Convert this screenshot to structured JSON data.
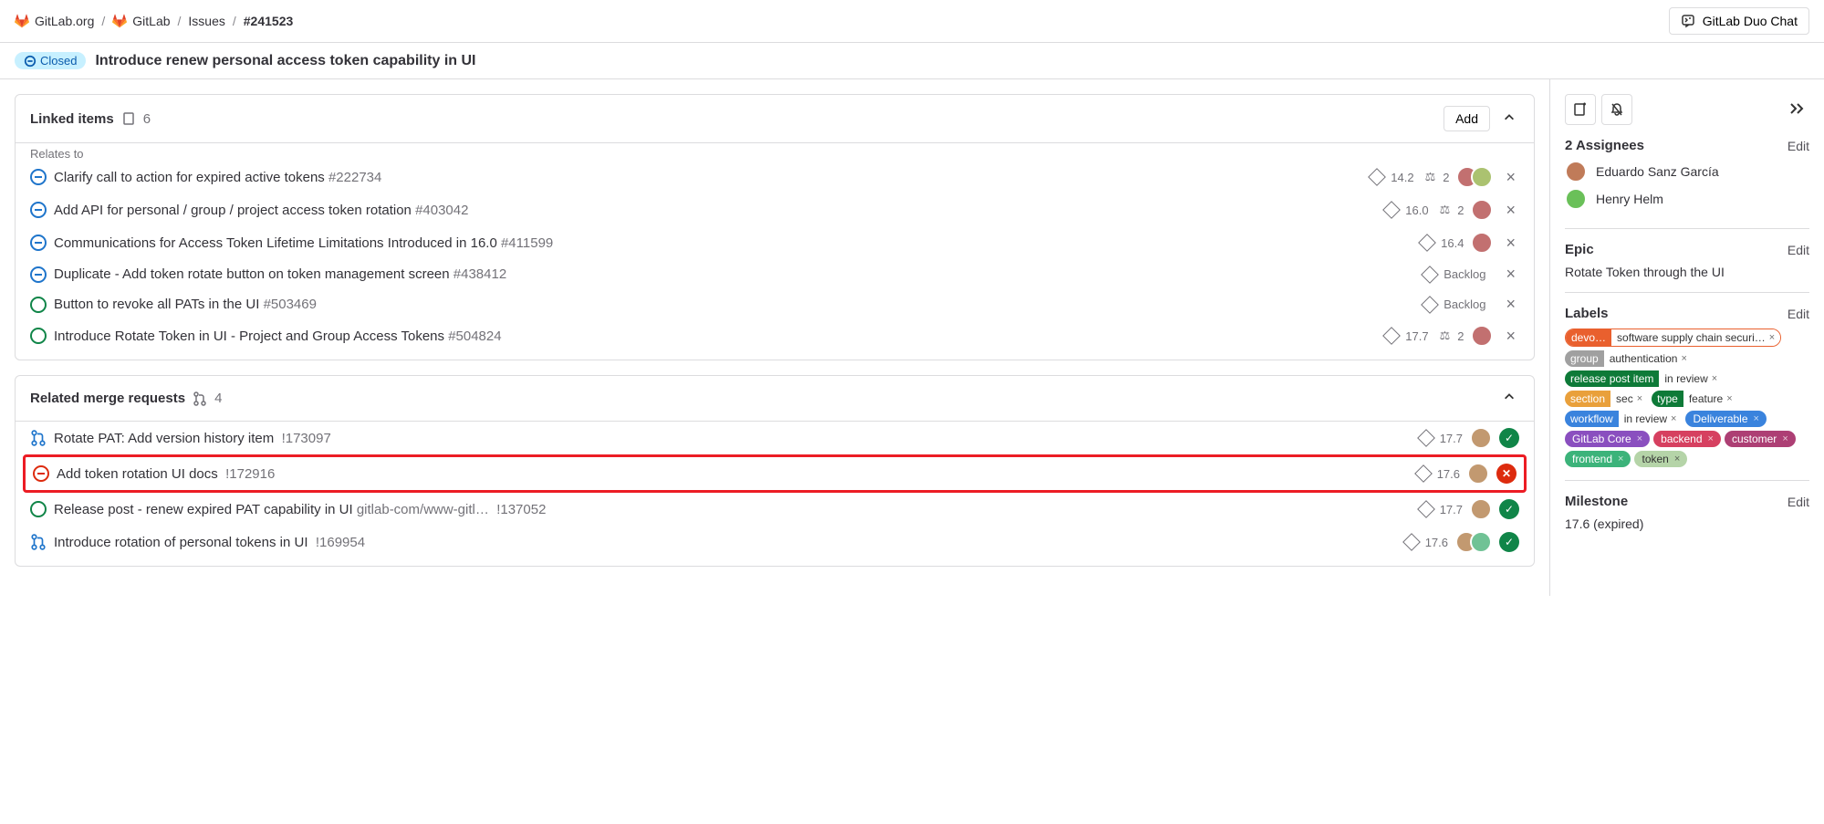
{
  "breadcrumbs": {
    "org": "GitLab.org",
    "project": "GitLab",
    "section": "Issues",
    "ref": "#241523"
  },
  "duo_chat": "GitLab Duo Chat",
  "status": "Closed",
  "title": "Introduce renew personal access token capability in UI",
  "linked_items": {
    "heading": "Linked items",
    "count": "6",
    "add": "Add",
    "relates_to": "Relates to",
    "items": [
      {
        "status": "closed",
        "title": "Clarify call to action for expired active tokens",
        "ref": "#222734",
        "milestone": "14.2",
        "weight": "2",
        "avatars": 2
      },
      {
        "status": "closed",
        "title": "Add API for personal / group / project access token rotation",
        "ref": "#403042",
        "milestone": "16.0",
        "weight": "2",
        "avatars": 1
      },
      {
        "status": "closed",
        "title": "Communications for Access Token Lifetime Limitations Introduced in 16.0",
        "ref": "#411599",
        "milestone": "16.4",
        "weight": "",
        "avatars": 1
      },
      {
        "status": "closed",
        "title": "Duplicate - Add token rotate button on token management screen",
        "ref": "#438412",
        "milestone": "Backlog",
        "weight": "",
        "avatars": 0
      },
      {
        "status": "open",
        "title": "Button to revoke all PATs in the UI",
        "ref": "#503469",
        "milestone": "Backlog",
        "weight": "",
        "avatars": 0
      },
      {
        "status": "open",
        "title": "Introduce Rotate Token in UI - Project and Group Access Tokens",
        "ref": "#504824",
        "milestone": "17.7",
        "weight": "2",
        "avatars": 1
      }
    ]
  },
  "related_mrs": {
    "heading": "Related merge requests",
    "count": "4",
    "items": [
      {
        "icon": "merge",
        "title": "Rotate PAT: Add version history item",
        "ref": "!173097",
        "milestone": "17.7",
        "avatars": 1,
        "pipeline": "pass",
        "highlight": false
      },
      {
        "icon": "closed-red",
        "title": "Add token rotation UI docs",
        "ref": "!172916",
        "milestone": "17.6",
        "avatars": 1,
        "pipeline": "fail",
        "highlight": true
      },
      {
        "icon": "open",
        "title": "Release post - renew expired PAT capability in UI",
        "refpre": "gitlab-com/www-gitl…",
        "ref": "!137052",
        "milestone": "17.7",
        "avatars": 1,
        "pipeline": "pass",
        "highlight": false
      },
      {
        "icon": "merge",
        "title": "Introduce rotation of personal tokens in UI",
        "ref": "!169954",
        "milestone": "17.6",
        "avatars": 2,
        "pipeline": "pass",
        "highlight": false
      }
    ]
  },
  "sidebar": {
    "assignees_title": "2 Assignees",
    "edit": "Edit",
    "assignees": [
      "Eduardo Sanz García",
      "Henry Helm"
    ],
    "epic_title": "Epic",
    "epic_value": "Rotate Token through the UI",
    "labels_title": "Labels",
    "labels": [
      {
        "scope": "devo…",
        "value": "software supply chain securi…",
        "color": "#e9602e",
        "outline": true
      },
      {
        "scope": "group",
        "value": "authentication",
        "color": "#a0a0a0"
      },
      {
        "scope": "release post item",
        "value": "in review",
        "color": "#0e7a38"
      },
      {
        "scope": "section",
        "value": "sec",
        "color": "#e9a03b"
      },
      {
        "scope": "type",
        "value": "feature",
        "color": "#0e7a38"
      },
      {
        "scope": "workflow",
        "value": "in review",
        "color": "#3a83dd"
      },
      {
        "simple": "Deliverable",
        "color": "#3a83dd"
      },
      {
        "simple": "GitLab Core",
        "color": "#8a4fbf"
      },
      {
        "simple": "backend",
        "color": "#d64060"
      },
      {
        "simple": "customer",
        "color": "#ad3f74"
      },
      {
        "simple": "frontend",
        "color": "#3cb37a"
      },
      {
        "simple": "token",
        "color": "#b5d4a8",
        "dark": true
      }
    ],
    "milestone_title": "Milestone",
    "milestone_value": "17.6 (expired)"
  }
}
